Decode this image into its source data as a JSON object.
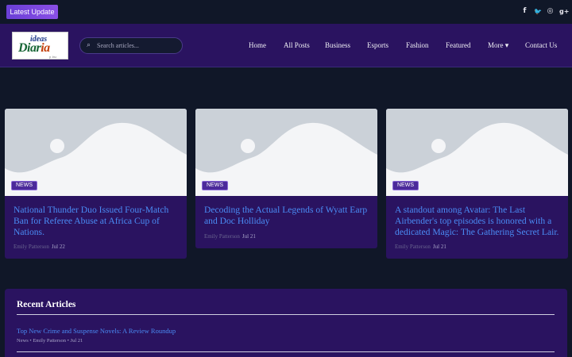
{
  "topbar": {
    "latest_label": "Latest Update",
    "social": [
      {
        "icon": "facebook-icon",
        "glyph": "f"
      },
      {
        "icon": "twitter-icon",
        "glyph": "🐦"
      },
      {
        "icon": "instagram-icon",
        "glyph": "◎"
      },
      {
        "icon": "google-plus-icon",
        "glyph": "g+"
      }
    ]
  },
  "header": {
    "logo": {
      "top": "ideas",
      "main_a": "Diar",
      "main_b": "ia",
      "small": "y .bu"
    },
    "search": {
      "placeholder": "Search articles..."
    },
    "nav": [
      "Home",
      "All Posts",
      "Business",
      "Esports",
      "Fashion",
      "Featured",
      "More ▾",
      "Contact Us"
    ]
  },
  "cards": [
    {
      "badge": "NEWS",
      "title": "National Thunder Duo Issued Four-Match Ban for Referee Abuse at Africa Cup of Nations.",
      "author": "Emily Patterson",
      "date": "Jul 22"
    },
    {
      "badge": "NEWS",
      "title": "Decoding the Actual Legends of Wyatt Earp and Doc Holliday",
      "author": "Emily Patterson",
      "date": "Jul 21"
    },
    {
      "badge": "NEWS",
      "title": "A standout among Avatar: The Last Airbender's top episodes is honored with a dedicated Magic: The Gathering Secret Lair.",
      "author": "Emily Patterson",
      "date": "Jul 21"
    }
  ],
  "recent": {
    "heading": "Recent Articles",
    "items": [
      {
        "title": "Top New Crime and Suspense Novels: A Review Roundup",
        "meta": "News • Emily Patterson • Jul 21"
      }
    ]
  },
  "colors": {
    "accent": "#4a8cf5",
    "header_bg": "#2a1360",
    "page_bg": "#101728"
  }
}
